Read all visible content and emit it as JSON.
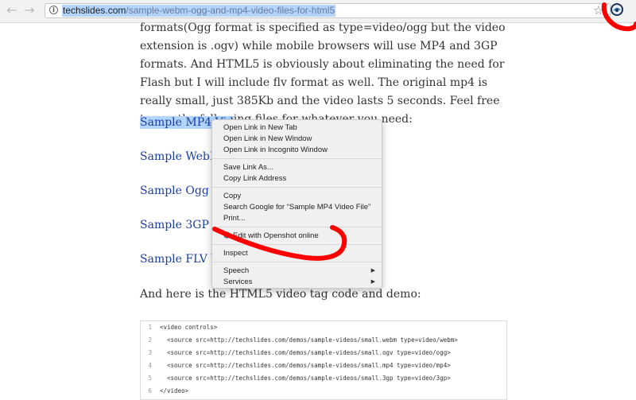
{
  "browser": {
    "url_domain": "techslides.com",
    "url_path": "/sample-webm-ogg-and-mp4-video-files-for-html5",
    "nav_back_icon": "back-arrow-icon",
    "nav_forward_icon": "forward-arrow-icon",
    "bookmark_icon": "star-icon",
    "extension_icon": "openshot-icon"
  },
  "article": {
    "intro": "formats(Ogg format is specified as type=video/ogg but the video extension is .ogv) while mobile browsers will use MP4 and 3GP formats. And HTML5 is obviously about eliminating the need for Flash but I will include flv format as well. The original mp4 is really small, just 385Kb and the video lasts 5 seconds. Feel free to use the following files for whatever you need:",
    "links": [
      "Sample MP4 Vid",
      "Sample WebM V",
      "Sample Ogg Vid",
      "Sample 3GP Vid",
      "Sample FLV Vid"
    ],
    "outro": "And here is the HTML5 video tag code and demo:"
  },
  "code": {
    "lines": [
      {
        "n": "1",
        "text": "<video controls>"
      },
      {
        "n": "2",
        "text": "  <source src=http://techslides.com/demos/sample-videos/small.webm type=video/webm>"
      },
      {
        "n": "3",
        "text": "  <source src=http://techslides.com/demos/sample-videos/small.ogv type=video/ogg>"
      },
      {
        "n": "4",
        "text": "  <source src=http://techslides.com/demos/sample-videos/small.mp4 type=video/mp4>"
      },
      {
        "n": "5",
        "text": "  <source src=http://techslides.com/demos/sample-videos/small.3gp type=video/3gp>"
      },
      {
        "n": "6",
        "text": "</video>"
      }
    ]
  },
  "context_menu": {
    "items": [
      "Open Link in New Tab",
      "Open Link in New Window",
      "Open Link in Incognito Window",
      "Save Link As...",
      "Copy Link Address",
      "Copy",
      "Search Google for “Sample MP4 Video File”",
      "Print...",
      "Edit with Openshot online",
      "Inspect",
      "Speech",
      "Services"
    ]
  },
  "colors": {
    "link": "#1a3fa0",
    "selection": "#b3d4fc",
    "annotation": "#ff0000"
  }
}
